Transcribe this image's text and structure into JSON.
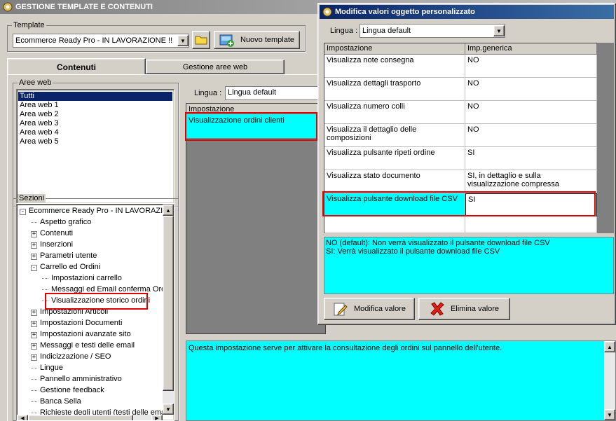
{
  "main_window": {
    "title": "GESTIONE TEMPLATE E CONTENUTI",
    "template_group_label": "Template",
    "template_value": "Ecommerce Ready Pro - IN LAVORAZIONE !!",
    "new_template_label": "Nuovo template",
    "tabs": [
      "Contenuti",
      "Gestione aree web"
    ],
    "aree_web_label": "Aree web",
    "aree_web_items": [
      "Tutti",
      "Area web 1",
      "Area web 2",
      "Area web 3",
      "Area web 4",
      "Area web 5"
    ],
    "sezioni_label": "Sezioni",
    "tree": [
      {
        "label": "Ecommerce Ready Pro - IN LAVORAZIONE !!",
        "level": 0,
        "expander": "-"
      },
      {
        "label": "Aspetto grafico",
        "level": 1,
        "expander": ""
      },
      {
        "label": "Contenuti",
        "level": 1,
        "expander": "+"
      },
      {
        "label": "Inserzioni",
        "level": 1,
        "expander": "+"
      },
      {
        "label": "Parametri utente",
        "level": 1,
        "expander": "+"
      },
      {
        "label": "Carrello ed Ordini",
        "level": 1,
        "expander": "-"
      },
      {
        "label": "Impostazioni carrello",
        "level": 2,
        "expander": ""
      },
      {
        "label": "Messaggi ed Email conferma Ordine",
        "level": 2,
        "expander": ""
      },
      {
        "label": "Visualizzazione storico ordini",
        "level": 2,
        "expander": ""
      },
      {
        "label": "Impostazioni Articoli",
        "level": 1,
        "expander": "+"
      },
      {
        "label": "Impostazioni Documenti",
        "level": 1,
        "expander": "+"
      },
      {
        "label": "Impostazioni avanzate sito",
        "level": 1,
        "expander": "+"
      },
      {
        "label": "Messaggi e testi delle email",
        "level": 1,
        "expander": "+"
      },
      {
        "label": "Indicizzazione / SEO",
        "level": 1,
        "expander": "+"
      },
      {
        "label": "Lingue",
        "level": 1,
        "expander": ""
      },
      {
        "label": "Pannello amministrativo",
        "level": 1,
        "expander": ""
      },
      {
        "label": "Gestione feedback",
        "level": 1,
        "expander": ""
      },
      {
        "label": "Banca Sella",
        "level": 1,
        "expander": ""
      },
      {
        "label": "Richieste degli utenti (testi delle email)",
        "level": 1,
        "expander": ""
      }
    ],
    "lingua_label": "Lingua :",
    "lingua_value": "Lingua default",
    "grid_header": "Impostazione",
    "grid_row": "Visualizzazione ordini clienti",
    "description": "Questa impostazione serve per attivare la consultazione degli ordini sul pannello dell'utente."
  },
  "dialog": {
    "title": "Modifica valori oggetto personalizzato",
    "lingua_label": "Lingua :",
    "lingua_value": "Lingua default",
    "col_setting": "Impostazione",
    "col_value": "Imp.generica",
    "rows": [
      {
        "setting": "Visualizza note consegna",
        "value": "NO"
      },
      {
        "setting": "Visualizza dettagli trasporto",
        "value": "NO"
      },
      {
        "setting": "Visualizza numero colli",
        "value": "NO"
      },
      {
        "setting": "Visualizza il dettaglio delle composizioni",
        "value": "NO"
      },
      {
        "setting": "Visualizza pulsante ripeti ordine",
        "value": "SI"
      },
      {
        "setting": "Visualizza stato documento",
        "value": "SI, in dettaglio e sulla visualizzazione compressa"
      },
      {
        "setting": "Visualizza pulsante download file CSV",
        "value": "SI"
      }
    ],
    "help_line1": "NO (default): Non verrà visualizzato il pulsante download file CSV",
    "help_line2": "SI: Verrà visualizzato il pulsante download file CSV",
    "modify_label": "Modifica valore",
    "delete_label": "Elimina valore"
  },
  "colors": {
    "highlight": "#00ffff",
    "selection": "#0a246a",
    "red_box": "#e00000"
  },
  "icons": [
    "app-icon",
    "folder-icon",
    "new-template-icon",
    "pencil-icon",
    "red-x-icon"
  ]
}
